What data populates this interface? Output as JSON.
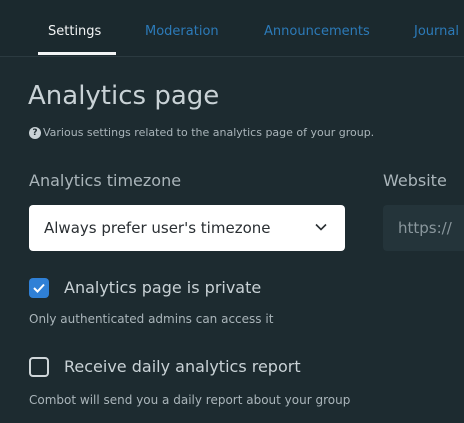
{
  "tabs": [
    {
      "label": "Settings",
      "active": true
    },
    {
      "label": "Moderation",
      "active": false
    },
    {
      "label": "Announcements",
      "active": false
    },
    {
      "label": "Journal",
      "active": false
    }
  ],
  "page": {
    "title": "Analytics page",
    "description": "Various settings related to the analytics page of your group."
  },
  "timezone": {
    "label": "Analytics timezone",
    "value": "Always prefer user's timezone"
  },
  "website": {
    "label": "Website",
    "value": "https://"
  },
  "private_toggle": {
    "label": "Analytics page is private",
    "checked": true,
    "hint": "Only authenticated admins can access it"
  },
  "daily_report": {
    "label": "Receive daily analytics report",
    "checked": false,
    "hint": "Combot will send you a daily report about your group"
  },
  "colors": {
    "background": "#1d2b30",
    "link": "#2c7ab8",
    "accent": "#2f80d6"
  }
}
